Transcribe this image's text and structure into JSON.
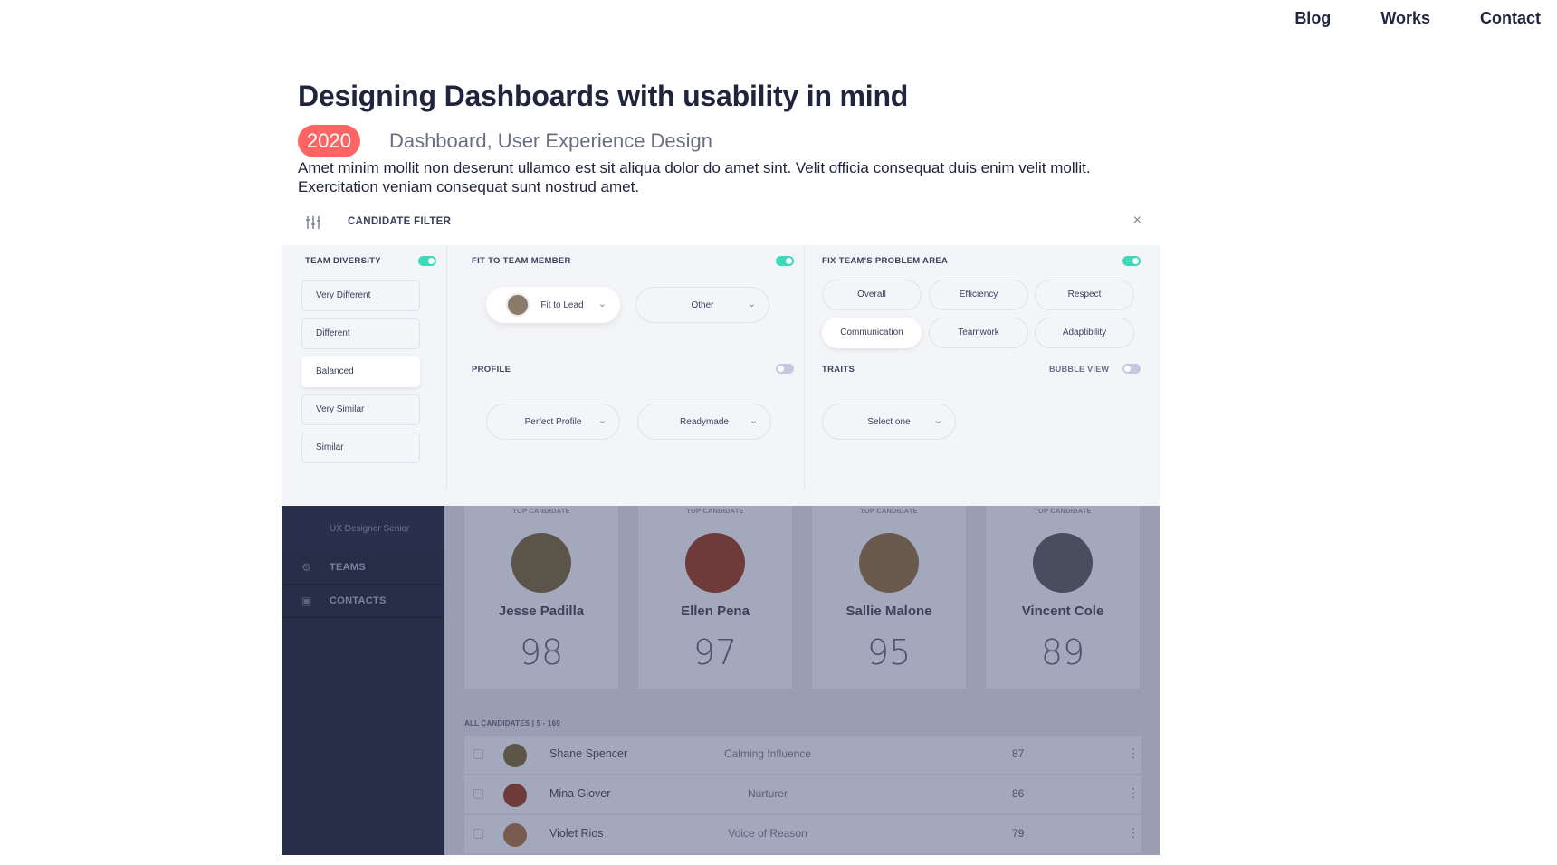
{
  "nav": {
    "items": [
      "Blog",
      "Works",
      "Contact"
    ]
  },
  "article": {
    "title": "Designing Dashboards with usability in mind",
    "year": "2020",
    "tags": "Dashboard, User Experience Design",
    "excerpt": "Amet minim mollit non deserunt ullamco est sit aliqua dolor do amet sint. Velit officia consequat duis enim velit mollit. Exercitation veniam consequat sunt nostrud amet."
  },
  "filter": {
    "title": "CANDIDATE FILTER",
    "icon": "sliders-icon",
    "close": "×",
    "team_diversity": {
      "label": "TEAM DIVERSITY",
      "enabled": true,
      "options": [
        "Very Different",
        "Different",
        "Balanced",
        "Very Similar",
        "Similar"
      ],
      "selected": "Balanced"
    },
    "fit_to_team_member": {
      "label": "FIT TO TEAM MEMBER",
      "enabled": true,
      "dropdown1": "Fit to Lead",
      "dropdown2": "Other"
    },
    "profile": {
      "label": "PROFILE",
      "enabled": false,
      "dropdown1": "Perfect Profile",
      "dropdown2": "Readymade"
    },
    "problem_area": {
      "label": "FIX TEAM'S PROBLEM AREA",
      "enabled": true,
      "options": [
        "Overall",
        "Efficiency",
        "Respect",
        "Communication",
        "Teamwork",
        "Adaptibility"
      ],
      "selected": "Communication"
    },
    "traits": {
      "label": "TRAITS",
      "bubble_label": "BUBBLE VIEW",
      "bubble_enabled": false,
      "dropdown": "Select one"
    }
  },
  "dashboard": {
    "sidebar": {
      "sub_item": "UX Designer Senior",
      "items": [
        "TEAMS",
        "CONTACTS"
      ]
    },
    "top_candidate_label": "TOP CANDIDATE",
    "top_candidates": [
      {
        "name": "Jesse Padilla",
        "score": "98"
      },
      {
        "name": "Ellen Pena",
        "score": "97"
      },
      {
        "name": "Sallie Malone",
        "score": "95"
      },
      {
        "name": "Vincent Cole",
        "score": "89"
      }
    ],
    "all_candidates_label": "ALL CANDIDATES  |  5 - 169",
    "candidates": [
      {
        "name": "Shane Spencer",
        "trait": "Calming Influence",
        "score": "87"
      },
      {
        "name": "Mina Glover",
        "trait": "Nurturer",
        "score": "86"
      },
      {
        "name": "Violet Rios",
        "trait": "Voice of Reason",
        "score": "79"
      }
    ]
  }
}
